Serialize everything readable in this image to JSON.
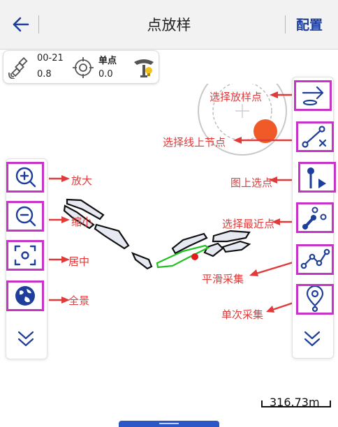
{
  "header": {
    "title": "点放样",
    "config_label": "配置"
  },
  "status": {
    "satellites": "00-21",
    "pdop": "0.8",
    "solution": "单点",
    "age": "0.0"
  },
  "tools_left": [
    {
      "id": "zoom-in",
      "label": "放大"
    },
    {
      "id": "zoom-out",
      "label": "缩小"
    },
    {
      "id": "center",
      "label": "居中"
    },
    {
      "id": "full-view",
      "label": "全景"
    }
  ],
  "tools_right": [
    {
      "id": "select-stake-point",
      "label": "选择放样点"
    },
    {
      "id": "select-line-node",
      "label": "选择线上节点"
    },
    {
      "id": "select-on-map",
      "label": "图上选点"
    },
    {
      "id": "select-nearest",
      "label": "选择最近点"
    },
    {
      "id": "smooth-collect",
      "label": "平滑采集"
    },
    {
      "id": "single-collect",
      "label": "单次采集"
    }
  ],
  "scale": {
    "text": "316.73m"
  },
  "colors": {
    "accent": "#1d3e9a",
    "annotation": "#e03a3a",
    "tool_border": "#c733c7",
    "stake_point": "#f05a28",
    "track": "#22c122",
    "nav_bar": "#2b57c7"
  },
  "icons": {
    "back": "arrow-left-icon",
    "satellite": "satellite-icon",
    "target": "crosshair-icon",
    "receiver": "gnss-receiver-icon",
    "zoom_in": "zoom-in-icon",
    "zoom_out": "zoom-out-icon",
    "center": "center-focus-icon",
    "full_view": "globe-icon",
    "expand": "chevron-double-down-icon"
  }
}
